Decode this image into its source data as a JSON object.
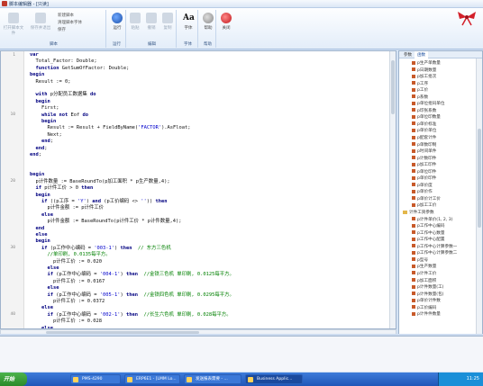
{
  "window": {
    "title": "脚本编辑器 - [只读]"
  },
  "ribbon": {
    "groups": [
      {
        "name": "脚本",
        "buttons": [
          "打开脚本文件",
          "保存并退出"
        ],
        "small": [
          "新建脚本",
          "清理脚本字体",
          "保存"
        ]
      },
      {
        "name": "运行",
        "buttons": [
          "运行"
        ]
      },
      {
        "name": "编辑",
        "buttons": [
          "粘贴",
          "撤销",
          "复制"
        ]
      },
      {
        "name": "字体",
        "buttons": [
          "字体"
        ]
      },
      {
        "name": "帮助",
        "buttons": [
          "帮助"
        ]
      },
      {
        "name": "关闭",
        "buttons": [
          "关闭"
        ]
      }
    ]
  },
  "editor": {
    "line_numbers": [
      "1",
      "10",
      "20",
      "30",
      "40"
    ],
    "code_lines": [
      "var",
      "  Total_Factor: Double;",
      "  function GetSumOfFactor: Double;",
      "begin",
      "  Result := 0;",
      "",
      "  with p分配员工数据集 do",
      "  begin",
      "    First;",
      "    while not Eof do",
      "    begin",
      "      Result := Result + FieldByName('FACTOR').AsFloat;",
      "      Next;",
      "    end;",
      "  end;",
      "end;",
      "",
      "",
      "begin",
      "  p计件数量 := BaseRoundTo(p加工面积 * p生产数量,4);",
      "  if p计件工价 > 0 then",
      "  begin",
      "    if ((p工序 = 'Y') and (p工价编码 <> '')) then",
      "      p计件金额 := p计件工价",
      "    else",
      "      p计件金额 := BaseRoundTo(p计件工价 * p计件数量,4);",
      "  end",
      "  else",
      "  begin",
      "    if (p工作中心编码 = '003-1') then  // 东方三色机",
      "      //单印刷, 0.0135每平方。",
      "        p计件工价 := 0.020",
      "      else",
      "      if (p工作中心编码 = '004-1') then  //金铁三色机 单印刷, 0.0125每平方。",
      "        p计件工价 := 0.0167",
      "      else",
      "      if (p工作中心编码 = '005-1') then  //金铁四色机 单印刷, 0.0295每平方。",
      "        p计件工价 := 0.0372",
      "    else",
      "      if (p工作中心编码 = '002-1') then  //长生六色机 单印刷, 0.028每平方。",
      "        p计件工价 := 0.028",
      "    else"
    ]
  },
  "right_panel": {
    "tabs": [
      "参数",
      "函数"
    ],
    "items": [
      "p生产单数量",
      "p日期数量",
      "p加工批次",
      "p工序",
      "p工价",
      "p系数",
      "p单位批码单位",
      "p印张系数",
      "p单位印数量",
      "p单价标准",
      "p单价单位",
      "p配套计件",
      "p单数印制",
      "p时间单件",
      "p计数印件",
      "p加工印件",
      "p单位印件",
      "p单价印件",
      "p单价度",
      "p单价作",
      "p单价计工价",
      "p加工工价",
      "计件工资参数",
      "p计件单价(1, 2, 3)",
      "p工作中心编码",
      "p工作中心数量",
      "p工作中心配置",
      "p工作中心计算参数一",
      "p工作中心计算参数二",
      "p型号",
      "p生产数量",
      "p计件工价",
      "p加工面积",
      "p计件数量(工)",
      "p计件数量(包)",
      "p单价计件数",
      "p工价编码",
      "p计件件数量"
    ]
  },
  "taskbar": {
    "start_label": "开始",
    "tasks": [
      "PMS-4290",
      "ERP6E1 - [LMM Lo...",
      "发送报表需要 - ...",
      "Business Applic..."
    ],
    "clock": "11:25"
  }
}
